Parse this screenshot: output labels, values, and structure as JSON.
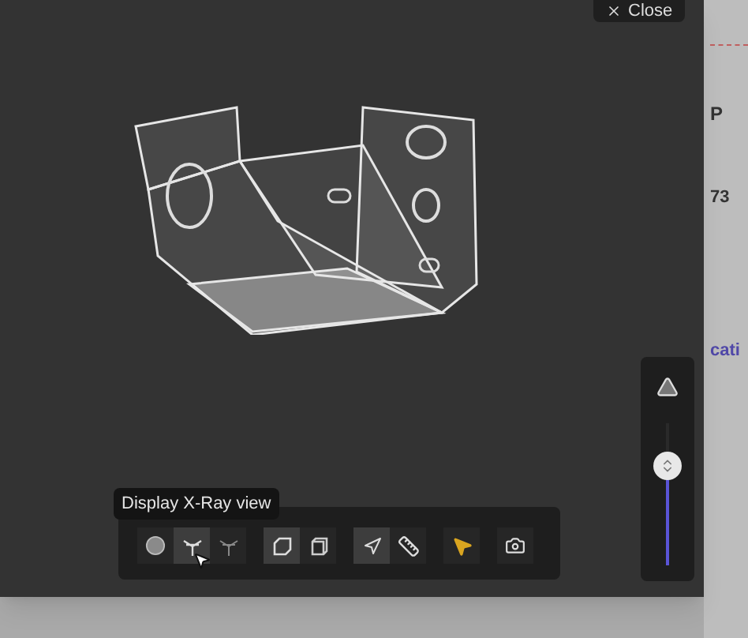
{
  "close_button": {
    "label": "Close"
  },
  "background_page": {
    "texts": [
      {
        "kind": "heading",
        "text": "P"
      },
      {
        "kind": "value",
        "text": "73"
      },
      {
        "kind": "link",
        "text": "cati"
      }
    ]
  },
  "tooltip": "Display X-Ray view",
  "toolbar": {
    "groups": [
      {
        "buttons": [
          {
            "kind": "solid",
            "selected": false
          },
          {
            "kind": "xray",
            "selected": true
          },
          {
            "kind": "wire",
            "selected": false
          }
        ]
      },
      {
        "buttons": [
          {
            "kind": "front",
            "selected": true
          },
          {
            "kind": "cube",
            "selected": false
          }
        ]
      },
      {
        "buttons": [
          {
            "kind": "navigate",
            "selected": true
          },
          {
            "kind": "ruler",
            "selected": false
          }
        ]
      },
      {
        "buttons": [
          {
            "kind": "cursor",
            "selected": false
          }
        ]
      },
      {
        "buttons": [
          {
            "kind": "camera",
            "selected": false
          }
        ]
      }
    ]
  },
  "slider": {
    "level": 0.7
  }
}
